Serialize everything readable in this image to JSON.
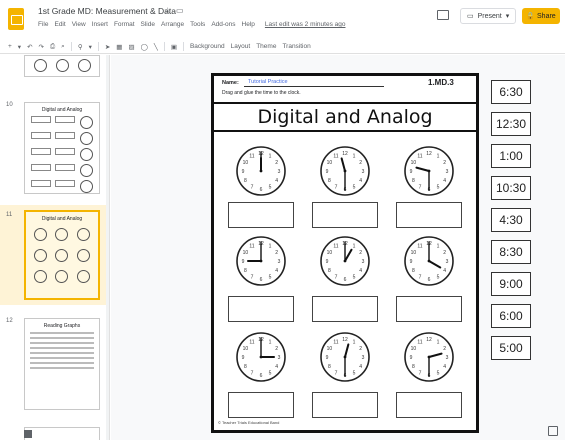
{
  "window": {
    "doc_title": "1st Grade MD: Measurement & Data",
    "menu_items": [
      "File",
      "Edit",
      "View",
      "Insert",
      "Format",
      "Slide",
      "Arrange",
      "Tools",
      "Add-ons",
      "Help"
    ],
    "last_edit": "Last edit was 2 minutes ago",
    "present_label": "Present",
    "share_label": "Share"
  },
  "toolbar": {
    "background_label": "Background",
    "layout_label": "Layout",
    "theme_label": "Theme",
    "transition_label": "Transition"
  },
  "filmstrip": {
    "slides": [
      {
        "num": "",
        "title": ""
      },
      {
        "num": "10",
        "title": "Digital and Analog"
      },
      {
        "num": "11",
        "title": "Digital and Analog"
      },
      {
        "num": "12",
        "title": "Reading Graphs"
      },
      {
        "num": "13",
        "title": ""
      }
    ]
  },
  "slide": {
    "name_label": "Name:",
    "name_value": "Tutorial Practice",
    "code": "1.MD.3",
    "instruction": "Drag and glue the time to the clock.",
    "heading": "Digital and Analog",
    "footer": "© Teacher Trials Educational Band",
    "clocks": [
      {
        "hour": 12,
        "minute": 0
      },
      {
        "hour": 11,
        "minute": 30
      },
      {
        "hour": 9,
        "minute": 30
      },
      {
        "hour": 9,
        "minute": 0
      },
      {
        "hour": 1,
        "minute": 0
      },
      {
        "hour": 4,
        "minute": 0
      },
      {
        "hour": 3,
        "minute": 0
      },
      {
        "hour": 12,
        "minute": 30
      },
      {
        "hour": 2,
        "minute": 30
      }
    ]
  },
  "answer_cards": [
    "6:30",
    "12:30",
    "1:00",
    "10:30",
    "4:30",
    "8:30",
    "9:00",
    "6:00",
    "5:00"
  ],
  "colors": {
    "accent": "#f4b400",
    "name_text": "#4169e1"
  }
}
